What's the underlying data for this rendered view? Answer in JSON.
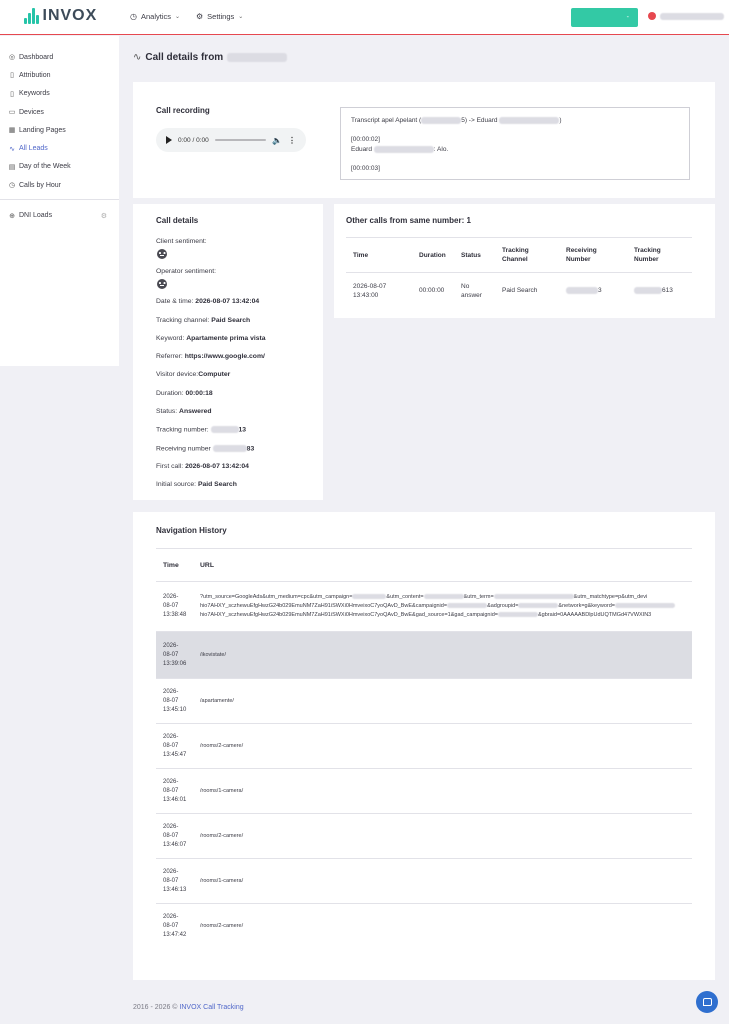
{
  "brand": {
    "name": "INVOX"
  },
  "topnav": {
    "analytics": "Analytics",
    "settings": "Settings",
    "green_button": "-"
  },
  "sidebar": {
    "items": [
      {
        "label": "Dashboard",
        "icon": "dashboard-icon"
      },
      {
        "label": "Attribution",
        "icon": "bookmark-icon"
      },
      {
        "label": "Keywords",
        "icon": "bookmark-icon"
      },
      {
        "label": "Devices",
        "icon": "monitor-icon"
      },
      {
        "label": "Landing Pages",
        "icon": "table-icon"
      },
      {
        "label": "All Leads",
        "icon": "pulse-icon",
        "active": true
      },
      {
        "label": "Day of the Week",
        "icon": "calendar-icon"
      },
      {
        "label": "Calls by Hour",
        "icon": "clock-icon"
      }
    ],
    "dni": {
      "label": "DNI Loads",
      "icon": "globe-icon"
    }
  },
  "page": {
    "title": "Call details from"
  },
  "recording": {
    "title": "Call recording",
    "time": "0:00 / 0:00"
  },
  "transcript": {
    "header_prefix": "Transcript apel Apelant (",
    "header_mid": "5) -> Eduard",
    "header_suffix": ")",
    "t1": "[00:00:02]",
    "speaker": "Eduard",
    "line1": ": Alo.",
    "t2": "[00:00:03]"
  },
  "details": {
    "title": "Call details",
    "client_sentiment": "Client sentiment:",
    "operator_sentiment": "Operator sentiment:",
    "datetime_label": "Date & time: ",
    "datetime": "2026-08-07 13:42:04",
    "channel_label": "Tracking channel: ",
    "channel": "Paid Search",
    "keyword_label": "Keyword: ",
    "keyword": "Apartamente prima vista",
    "referrer_label": "Referrer: ",
    "referrer": "https://www.google.com/",
    "device_label": "Visitor device:",
    "device": "Computer",
    "duration_label": "Duration: ",
    "duration": "00:00:18",
    "status_label": "Status: ",
    "status": "Answered",
    "tracking_label": "Tracking number: ",
    "tracking_suffix": "13",
    "receiving_label": "Receiving number ",
    "receiving_suffix": "83",
    "first_call_label": "First call: ",
    "first_call": "2026-08-07 13:42:04",
    "initial_source_label": "Initial source: ",
    "initial_source": "Paid Search"
  },
  "other_calls": {
    "title": "Other calls from same number: 1",
    "headers": [
      "Time",
      "Duration",
      "Status",
      "Tracking Channel",
      "Receiving Number",
      "Tracking Number"
    ],
    "row": {
      "time": "2026-08-07 13:43:00",
      "duration": "00:00:00",
      "status": "No answer",
      "channel": "Paid Search",
      "receiving_suffix": "3",
      "tracking_suffix": "613"
    }
  },
  "navigation": {
    "title": "Navigation History",
    "headers": [
      "Time",
      "URL"
    ],
    "rows": [
      {
        "date1": "2026-",
        "date2": "08-07",
        "time": "13:38:48",
        "url": "?utm_source=GoogleAds&utm_medium=cpc&utm_campaign=",
        "url2": "hio7AHXY_sczhewuEfgHwzG24b029EmuNM7ZaH91iSWXi0HmveixoC7yoQAvD_BwE&campaignid=",
        "url3": "hio7AHXY_sczhewuEfgHwzG24b029EmuNM7ZaH91iSWXi0HmveixoC7yoQAvD_BwE&gad_source=1&gad_campaignid="
      },
      {
        "date1": "2026-",
        "date2": "08-07",
        "time": "13:39:06",
        "url": "/ikovistate/",
        "highlight": true
      },
      {
        "date1": "2026-",
        "date2": "08-07",
        "time": "13:45:10",
        "url": "/apartamente/"
      },
      {
        "date1": "2026-",
        "date2": "08-07",
        "time": "13:45:47",
        "url": "/rooms/2-camere/"
      },
      {
        "date1": "2026-",
        "date2": "08-07",
        "time": "13:46:01",
        "url": "/rooms/1-camera/"
      },
      {
        "date1": "2026-",
        "date2": "08-07",
        "time": "13:46:07",
        "url": "/rooms/2-camere/"
      },
      {
        "date1": "2026-",
        "date2": "08-07",
        "time": "13:46:13",
        "url": "/rooms/1-camera/"
      },
      {
        "date1": "2026-",
        "date2": "08-07",
        "time": "13:47:42",
        "url": "/rooms/2-camere/"
      }
    ],
    "url_fragments": {
      "content": "&utm_content=",
      "term": "&utm_term=",
      "matchtype": "&utm_matchtype=p&utm_devi",
      "adgroup": "&adgroupid=",
      "network": "&network=g&keyword=",
      "gbraid": "&gbraid=0AAAAABDlpUdUQTMGd47VWXIN3"
    }
  },
  "footer": {
    "years": "2016 - 2026 © ",
    "brand": "INVOX Call Tracking"
  },
  "colors": {
    "accent": "#33c9a5",
    "link": "#5067c9",
    "top_border": "#e6484f"
  }
}
